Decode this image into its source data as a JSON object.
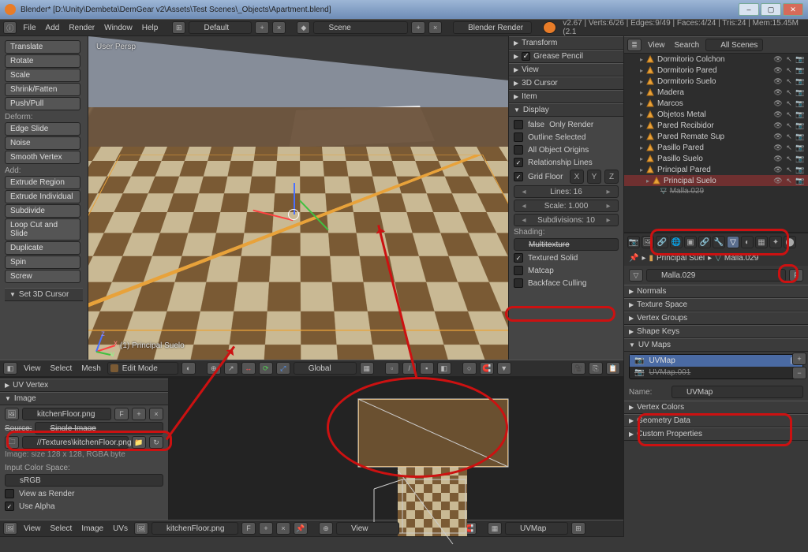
{
  "window": {
    "title": "Blender* [D:\\Unity\\Dembeta\\DemGear v2\\Assets\\Test Scenes\\_Objects\\Apartment.blend]"
  },
  "info": {
    "menus": [
      "File",
      "Add",
      "Render",
      "Window",
      "Help"
    ],
    "layout": "Default",
    "scene": "Scene",
    "engine": "Blender Render",
    "stats": "v2.67 | Verts:6/26 | Edges:9/49 | Faces:4/24 | Tris:24 | Mem:15.45M (2.1"
  },
  "toolshelf": {
    "groups": [
      {
        "title": "",
        "items": [
          "Translate",
          "Rotate",
          "Scale",
          "Shrink/Fatten",
          "Push/Pull"
        ]
      },
      {
        "title": "Deform:",
        "items": [
          "Edge Slide",
          "Noise",
          "Smooth Vertex"
        ]
      },
      {
        "title": "Add:",
        "items": [
          "Extrude Region",
          "Extrude Individual",
          "Subdivide",
          "Loop Cut and Slide",
          "Duplicate",
          "Spin",
          "Screw"
        ]
      }
    ],
    "operator_panel": "Set 3D Cursor"
  },
  "view3d": {
    "hud_persp": "User Persp",
    "hud_obj": "(1) Principal Suelo",
    "header": {
      "menus": [
        "View",
        "Select",
        "Mesh"
      ],
      "mode": "Edit Mode",
      "orient": "Global"
    }
  },
  "npanel": {
    "sections_collapsed": [
      "Transform",
      "Grease Pencil",
      "View",
      "3D Cursor",
      "Item"
    ],
    "grease_pencil_checked": true,
    "display": {
      "only_render": false,
      "outline_selected": false,
      "all_origins": false,
      "relationship_lines": true,
      "grid_floor": true,
      "grid_axes": [
        "X",
        "Y",
        "Z"
      ],
      "lines": "Lines: 16",
      "scale": "Scale: 1.000",
      "subdiv": "Subdivisions: 10",
      "shading_label": "Shading:",
      "multitexture": "Multitexture",
      "textured_solid": "Textured Solid",
      "matcap": "Matcap",
      "backface": "Backface Culling"
    }
  },
  "uv": {
    "n": {
      "uv_vertex": "UV Vertex",
      "image": "Image",
      "image_name": "kitchenFloor.png",
      "source_label": "Source:",
      "source": "Single Image",
      "path": "//Textures\\kitchenFloor.png",
      "meta": "Image: size 128 x 128, RGBA byte",
      "ics_label": "Input Color Space:",
      "ics": "sRGB",
      "view_as_render": "View as Render",
      "use_alpha": "Use Alpha"
    },
    "header": {
      "menus": [
        "View",
        "Select",
        "Image",
        "UVs"
      ],
      "image_name": "kitchenFloor.png",
      "view_menu": "View",
      "uvmap": "UVMap"
    }
  },
  "outliner": {
    "header": {
      "view": "View",
      "search": "Search",
      "filter": "All Scenes"
    },
    "items": [
      {
        "label": "Dormitorio Colchon"
      },
      {
        "label": "Dormitorio Pared"
      },
      {
        "label": "Dormitorio Suelo"
      },
      {
        "label": "Madera"
      },
      {
        "label": "Marcos"
      },
      {
        "label": "Objetos Metal"
      },
      {
        "label": "Pared Recibidor"
      },
      {
        "label": "Pared Remate Sup"
      },
      {
        "label": "Pasillo Pared"
      },
      {
        "label": "Pasillo Suelo"
      },
      {
        "label": "Principal Pared"
      }
    ],
    "selected": {
      "label": "Principal Suelo",
      "child": "Malla.029"
    }
  },
  "props": {
    "breadcrumb": {
      "obj": "Principal Suel",
      "mesh": "Malla.029"
    },
    "mesh_name": "Malla.029",
    "sections": [
      "Normals",
      "Texture Space",
      "Vertex Groups",
      "Shape Keys"
    ],
    "uvmaps": {
      "title": "UV Maps",
      "rows": [
        {
          "name": "UVMap",
          "sel": true
        },
        {
          "name": "UVMap.001",
          "sel": false,
          "crossed": true
        }
      ],
      "name_label": "Name:",
      "name_value": "UVMap"
    },
    "sections2": [
      "Vertex Colors",
      "Geometry Data",
      "Custom Properties"
    ]
  }
}
